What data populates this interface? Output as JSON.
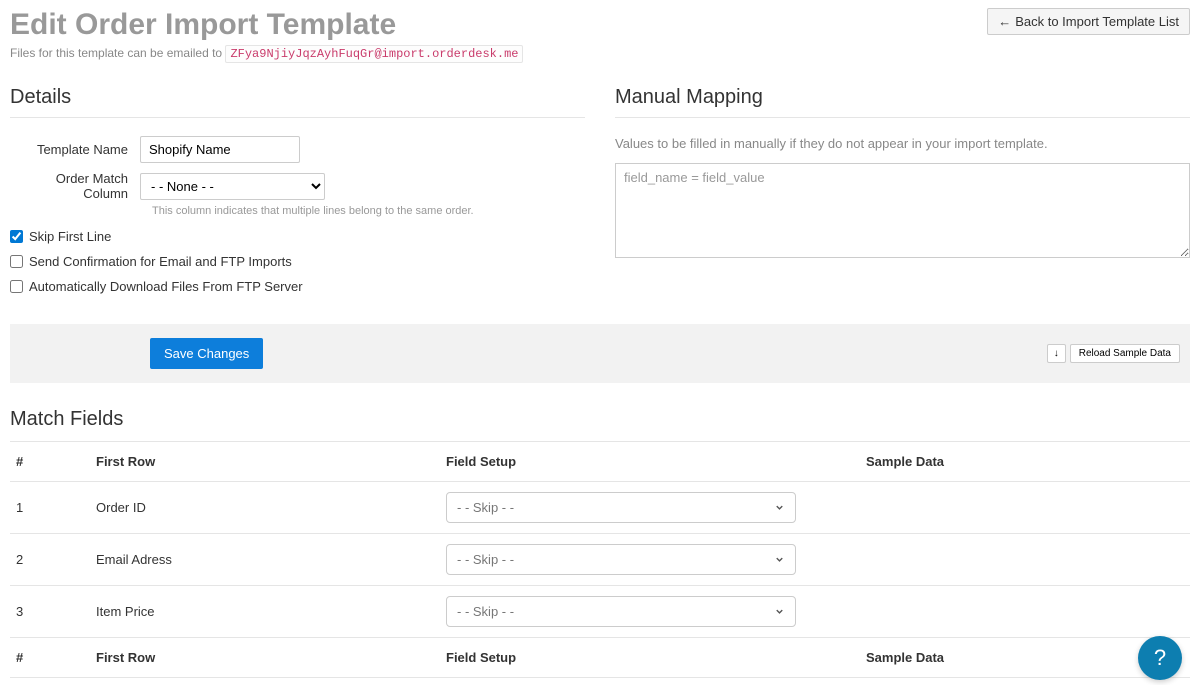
{
  "header": {
    "title": "Edit Order Import Template",
    "back_button": "Back to Import Template List",
    "subtext_prefix": "Files for this template can be emailed to ",
    "email": "ZFya9NjiyJqzAyhFuqGr@import.orderdesk.me"
  },
  "details": {
    "title": "Details",
    "template_name_label": "Template Name",
    "template_name_value": "Shopify Name",
    "order_match_label": "Order Match Column",
    "order_match_value": "- - None - -",
    "order_match_help": "This column indicates that multiple lines belong to the same order.",
    "skip_first_line": "Skip First Line",
    "send_confirmation": "Send Confirmation for Email and FTP Imports",
    "auto_download": "Automatically Download Files From FTP Server"
  },
  "mapping": {
    "title": "Manual Mapping",
    "help": "Values to be filled in manually if they do not appear in your import template.",
    "placeholder": "field_name = field_value"
  },
  "actions": {
    "save": "Save Changes",
    "reload": "Reload Sample Data",
    "down_icon": "↓"
  },
  "match": {
    "title": "Match Fields",
    "headers": {
      "idx": "#",
      "first_row": "First Row",
      "field_setup": "Field Setup",
      "sample_data": "Sample Data"
    },
    "rows": [
      {
        "idx": "1",
        "first_row": "Order ID",
        "field_setup": "- - Skip - -",
        "sample": ""
      },
      {
        "idx": "2",
        "first_row": "Email Adress",
        "field_setup": "- - Skip - -",
        "sample": ""
      },
      {
        "idx": "3",
        "first_row": "Item Price",
        "field_setup": "- - Skip - -",
        "sample": ""
      }
    ]
  },
  "help_fab": "?"
}
